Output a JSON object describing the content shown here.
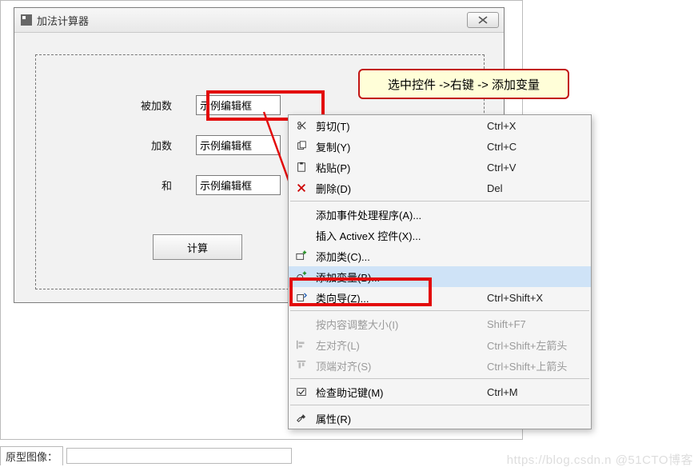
{
  "window": {
    "title": "加法计算器",
    "close_tooltip": "关闭"
  },
  "form": {
    "addend1_label": "被加数",
    "addend2_label": "加数",
    "sum_label": "和",
    "sample_value": "示例编辑框",
    "calc_button": "计算"
  },
  "callout": {
    "text": "选中控件 ->右键 -> 添加变量"
  },
  "menu": {
    "items": [
      {
        "id": "cut",
        "icon": "scissors",
        "label": "剪切(T)",
        "shortcut": "Ctrl+X"
      },
      {
        "id": "copy",
        "icon": "copy",
        "label": "复制(Y)",
        "shortcut": "Ctrl+C"
      },
      {
        "id": "paste",
        "icon": "paste",
        "label": "粘贴(P)",
        "shortcut": "Ctrl+V"
      },
      {
        "id": "delete",
        "icon": "x",
        "label": "删除(D)",
        "shortcut": "Del"
      },
      {
        "sep": true
      },
      {
        "id": "addhandler",
        "icon": "",
        "label": "添加事件处理程序(A)..."
      },
      {
        "id": "insertax",
        "icon": "",
        "label": "插入 ActiveX 控件(X)..."
      },
      {
        "id": "addclass",
        "icon": "addclass",
        "label": "添加类(C)..."
      },
      {
        "id": "addvar",
        "icon": "addvar",
        "label": "添加变量(B)...",
        "selected": true
      },
      {
        "id": "classwiz",
        "icon": "classwiz",
        "label": "类向导(Z)...",
        "shortcut": "Ctrl+Shift+X"
      },
      {
        "sep": true
      },
      {
        "id": "sizecontent",
        "icon": "",
        "label": "按内容调整大小(I)",
        "shortcut": "Shift+F7",
        "disabled": true
      },
      {
        "id": "alignleft",
        "icon": "alignl",
        "label": "左对齐(L)",
        "shortcut": "Ctrl+Shift+左箭头",
        "disabled": true
      },
      {
        "id": "aligntop",
        "icon": "alignt",
        "label": "顶端对齐(S)",
        "shortcut": "Ctrl+Shift+上箭头",
        "disabled": true
      },
      {
        "sep": true
      },
      {
        "id": "mnemonics",
        "icon": "check",
        "label": "检查助记键(M)",
        "shortcut": "Ctrl+M"
      },
      {
        "sep": true
      },
      {
        "id": "props",
        "icon": "wrench",
        "label": "属性(R)"
      }
    ]
  },
  "bottom": {
    "label": "原型图像：",
    "watermark": "https://blog.csdn.n @51CTO博客"
  }
}
